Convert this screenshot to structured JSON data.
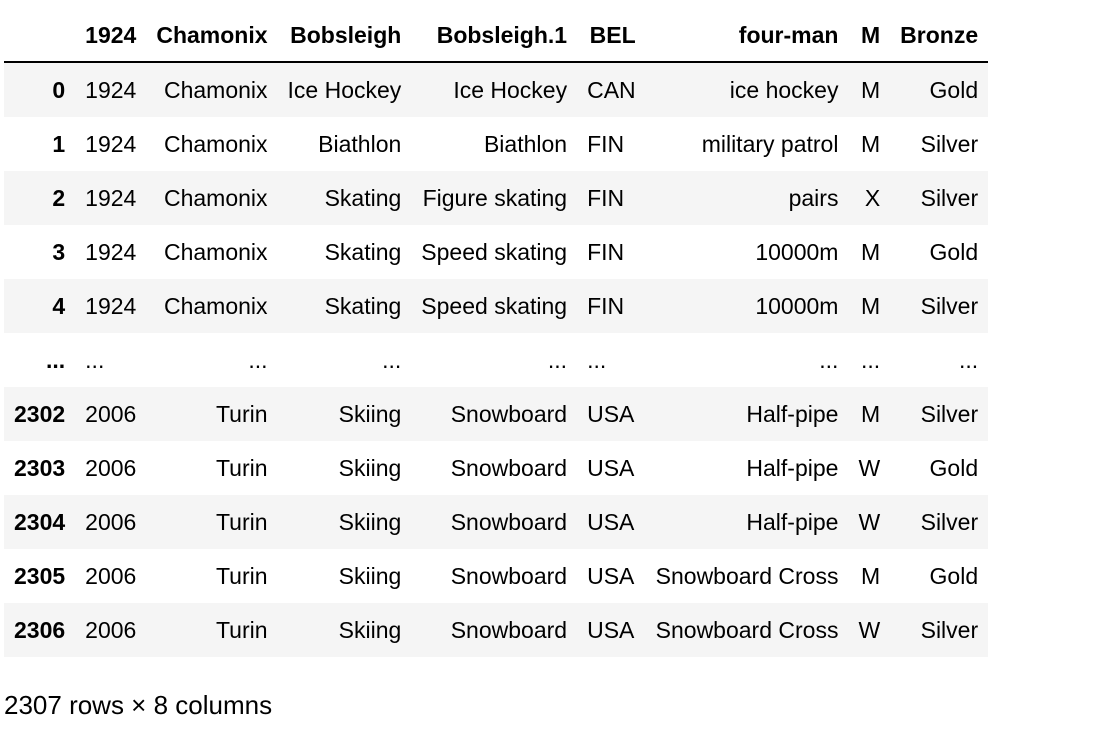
{
  "table": {
    "columns": [
      "",
      "1924",
      "Chamonix",
      "Bobsleigh",
      "Bobsleigh.1",
      "BEL",
      "four-man",
      "M",
      "Bronze"
    ],
    "rows": [
      {
        "index": "0",
        "cells": [
          "1924",
          "Chamonix",
          "Ice Hockey",
          "Ice Hockey",
          "CAN",
          "ice hockey",
          "M",
          "Gold"
        ]
      },
      {
        "index": "1",
        "cells": [
          "1924",
          "Chamonix",
          "Biathlon",
          "Biathlon",
          "FIN",
          "military patrol",
          "M",
          "Silver"
        ]
      },
      {
        "index": "2",
        "cells": [
          "1924",
          "Chamonix",
          "Skating",
          "Figure skating",
          "FIN",
          "pairs",
          "X",
          "Silver"
        ]
      },
      {
        "index": "3",
        "cells": [
          "1924",
          "Chamonix",
          "Skating",
          "Speed skating",
          "FIN",
          "10000m",
          "M",
          "Gold"
        ]
      },
      {
        "index": "4",
        "cells": [
          "1924",
          "Chamonix",
          "Skating",
          "Speed skating",
          "FIN",
          "10000m",
          "M",
          "Silver"
        ]
      },
      {
        "index": "...",
        "cells": [
          "...",
          "...",
          "...",
          "...",
          "...",
          "...",
          "...",
          "..."
        ]
      },
      {
        "index": "2302",
        "cells": [
          "2006",
          "Turin",
          "Skiing",
          "Snowboard",
          "USA",
          "Half-pipe",
          "M",
          "Silver"
        ]
      },
      {
        "index": "2303",
        "cells": [
          "2006",
          "Turin",
          "Skiing",
          "Snowboard",
          "USA",
          "Half-pipe",
          "W",
          "Gold"
        ]
      },
      {
        "index": "2304",
        "cells": [
          "2006",
          "Turin",
          "Skiing",
          "Snowboard",
          "USA",
          "Half-pipe",
          "W",
          "Silver"
        ]
      },
      {
        "index": "2305",
        "cells": [
          "2006",
          "Turin",
          "Skiing",
          "Snowboard",
          "USA",
          "Snowboard Cross",
          "M",
          "Gold"
        ]
      },
      {
        "index": "2306",
        "cells": [
          "2006",
          "Turin",
          "Skiing",
          "Snowboard",
          "USA",
          "Snowboard Cross",
          "W",
          "Silver"
        ]
      }
    ]
  },
  "footer": {
    "shape_text": "2307 rows × 8 columns"
  },
  "colors": {
    "stripe": "#f5f5f5",
    "header_border": "#000000",
    "text": "#000000"
  }
}
